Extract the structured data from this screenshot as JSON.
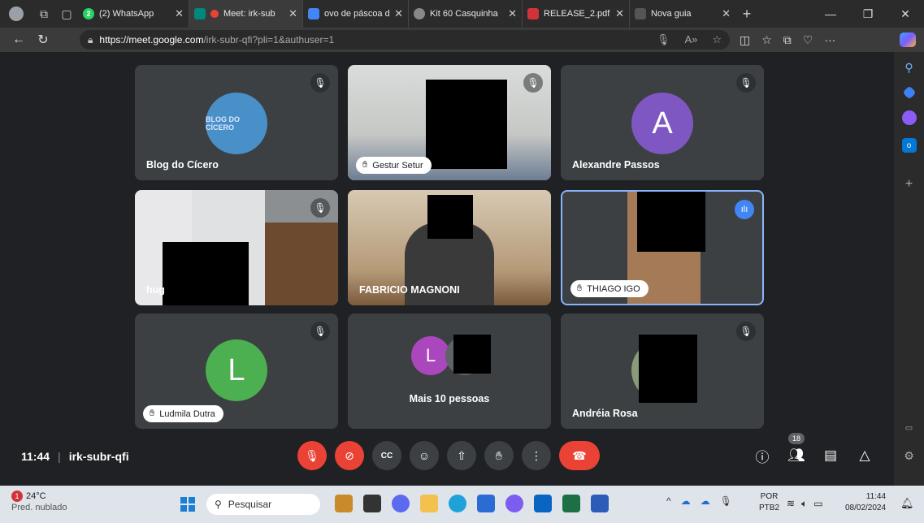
{
  "browser": {
    "profile_icon": "profile-icon",
    "tabs": [
      {
        "title": "(2) WhatsApp",
        "favicon_color": "#25d366",
        "badge": "2"
      },
      {
        "title": "Meet: irk-sub",
        "favicon_color": "#00897b",
        "active": true
      },
      {
        "title": "ovo de páscoa de",
        "favicon_color": "#4285f4"
      },
      {
        "title": "Kit 60 Casquinha",
        "favicon_color": "#888888"
      },
      {
        "title": "RELEASE_2.pdf",
        "favicon_color": "#d13438"
      },
      {
        "title": "Nova guia",
        "favicon_color": "#555555"
      }
    ],
    "url_host": "https://meet.google.com",
    "url_path": "/irk-subr-qfi?pli=1&authuser=1"
  },
  "meet": {
    "code": "irk-subr-qfi",
    "time": "11:44",
    "participants_count": "18",
    "tiles": [
      {
        "name": "Blog do Cícero",
        "avatar_text": "BLOG DO CÍCERO",
        "muted": true
      },
      {
        "name": "Gestur Setur",
        "muted": true
      },
      {
        "name": "Alexandre Passos",
        "avatar_letter": "A",
        "avatar_color": "#7e57c2",
        "muted": true
      },
      {
        "name": "hug",
        "muted": true
      },
      {
        "name": "FABRICIO MAGNONI",
        "muted": false
      },
      {
        "name": "THIAGO IGO",
        "speaking": true
      },
      {
        "name": "Ludmila Dutra",
        "avatar_letter": "L",
        "avatar_color": "#4caf50",
        "muted": true
      },
      {
        "name": "Mais 10 pessoas",
        "avatar_letter": "L",
        "avatar_color": "#ab47bc"
      },
      {
        "name": "Andréia Rosa",
        "muted": true
      }
    ]
  },
  "taskbar": {
    "temp": "24°C",
    "weather": "Pred. nublado",
    "weather_badge": "1",
    "search_placeholder": "Pesquisar",
    "lang1": "POR",
    "lang2": "PTB2",
    "time": "11:44",
    "date": "08/02/2024"
  }
}
